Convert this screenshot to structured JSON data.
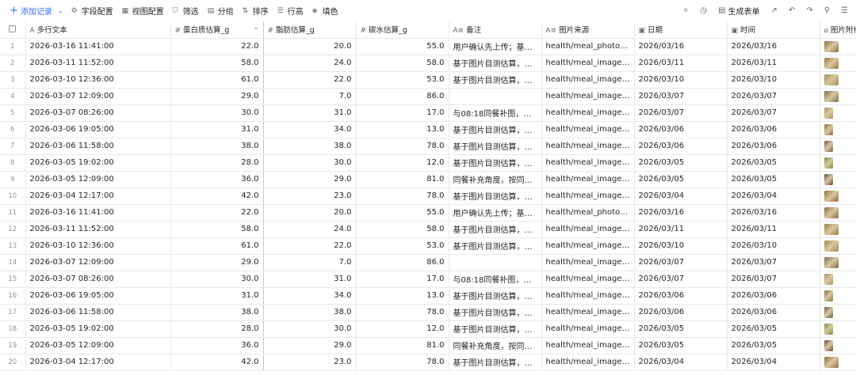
{
  "toolbar": {
    "add_record": "添加记录",
    "items": [
      {
        "label": "字段配置",
        "icon": "gear-icon"
      },
      {
        "label": "视图配置",
        "icon": "view-config-icon"
      },
      {
        "label": "筛选",
        "icon": "filter-icon"
      },
      {
        "label": "分组",
        "icon": "group-icon"
      },
      {
        "label": "排序",
        "icon": "sort-icon"
      },
      {
        "label": "行高",
        "icon": "row-height-icon"
      },
      {
        "label": "填色",
        "icon": "fill-color-icon"
      }
    ],
    "generate_form": "生成表单"
  },
  "columns": [
    {
      "label": "多行文本",
      "icon": "A"
    },
    {
      "label": "蛋白质估算_g",
      "icon": "#"
    },
    {
      "label": "脂肪估算_g",
      "icon": "#"
    },
    {
      "label": "碳水估算_g",
      "icon": "#"
    },
    {
      "label": "备注",
      "icon": "A≡"
    },
    {
      "label": "图片来源",
      "icon": "A≡"
    },
    {
      "label": "日期",
      "icon": "cal"
    },
    {
      "label": "时间",
      "icon": "cal"
    },
    {
      "label": "图片附件",
      "icon": "clip"
    }
  ],
  "rows": [
    {
      "idx": "1",
      "text": "2026-03-16 11:41:00",
      "protein": "22.0",
      "fat": "20.0",
      "carb": "55.0",
      "note": "用户确认先上传；基于...",
      "src": "health/meal_photos/202...",
      "date": "2026/03/16",
      "time": "2026/03/16",
      "thumb": "#8a6a3a"
    },
    {
      "idx": "2",
      "text": "2026-03-11 11:52:00",
      "protein": "58.0",
      "fat": "24.0",
      "carb": "58.0",
      "note": "基于图片目测估算，误...",
      "src": "health/meal_images/20...",
      "date": "2026/03/11",
      "time": "2026/03/11",
      "thumb": "#9a7a40"
    },
    {
      "idx": "3",
      "text": "2026-03-10 12:36:00",
      "protein": "61.0",
      "fat": "22.0",
      "carb": "53.0",
      "note": "基于图片目测估算，误...",
      "src": "health/meal_images/20...",
      "date": "2026/03/10",
      "time": "2026/03/10",
      "thumb": "#a08a50"
    },
    {
      "idx": "4",
      "text": "2026-03-07 12:09:00",
      "protein": "29.0",
      "fat": "7.0",
      "carb": "86.0",
      "note": "",
      "src": "health/meal_images/20...",
      "date": "2026/03/07",
      "time": "2026/03/07",
      "thumb": "#7a6a48"
    },
    {
      "idx": "5",
      "text": "2026-03-07 08:26:00",
      "protein": "30.0",
      "fat": "31.0",
      "carb": "17.0",
      "note": "与08:18同餐补图，按食...",
      "src": "health/meal_images/20...",
      "date": "2026/03/07",
      "time": "2026/03/07",
      "thumb": "#b09060",
      "narrow": true
    },
    {
      "idx": "6",
      "text": "2026-03-06 19:05:00",
      "protein": "31.0",
      "fat": "34.0",
      "carb": "13.0",
      "note": "基于图片目测估算，低...",
      "src": "health/meal_images/20...",
      "date": "2026/03/06",
      "time": "2026/03/06",
      "thumb": "#8a7040",
      "narrow": true
    },
    {
      "idx": "7",
      "text": "2026-03-06 11:58:00",
      "protein": "38.0",
      "fat": "38.0",
      "carb": "78.0",
      "note": "基于图片目测估算，肉...",
      "src": "health/meal_images/20...",
      "date": "2026/03/06",
      "time": "2026/03/06",
      "thumb": "#6a5a48",
      "narrow": true
    },
    {
      "idx": "8",
      "text": "2026-03-05 19:02:00",
      "protein": "28.0",
      "fat": "30.0",
      "carb": "12.0",
      "note": "基于图片目测估算，低...",
      "src": "health/meal_images/20...",
      "date": "2026/03/05",
      "time": "2026/03/05",
      "thumb": "#7a8a40",
      "narrow": true
    },
    {
      "idx": "9",
      "text": "2026-03-05 12:09:00",
      "protein": "36.0",
      "fat": "29.0",
      "carb": "81.0",
      "note": "同餐补充角度，按同一...",
      "src": "health/meal_images/20...",
      "date": "2026/03/05",
      "time": "2026/03/05",
      "thumb": "#5a4a3a",
      "narrow": true
    },
    {
      "idx": "10",
      "text": "2026-03-04 12:17:00",
      "protein": "42.0",
      "fat": "23.0",
      "carb": "78.0",
      "note": "基于图片目测估算，误...",
      "src": "health/meal_images/20...",
      "date": "2026/03/04",
      "time": "2026/03/04",
      "thumb": "#9a6a38"
    },
    {
      "idx": "11",
      "text": "2026-03-16 11:41:00",
      "protein": "22.0",
      "fat": "20.0",
      "carb": "55.0",
      "note": "用户确认先上传；基于...",
      "src": "health/meal_photos/202...",
      "date": "2026/03/16",
      "time": "2026/03/16",
      "thumb": "#8a6a3a"
    },
    {
      "idx": "12",
      "text": "2026-03-11 11:52:00",
      "protein": "58.0",
      "fat": "24.0",
      "carb": "58.0",
      "note": "基于图片目测估算，误...",
      "src": "health/meal_images/20...",
      "date": "2026/03/11",
      "time": "2026/03/11",
      "thumb": "#9a7a40"
    },
    {
      "idx": "13",
      "text": "2026-03-10 12:36:00",
      "protein": "61.0",
      "fat": "22.0",
      "carb": "53.0",
      "note": "基于图片目测估算，误...",
      "src": "health/meal_images/20...",
      "date": "2026/03/10",
      "time": "2026/03/10",
      "thumb": "#a08a50"
    },
    {
      "idx": "14",
      "text": "2026-03-07 12:09:00",
      "protein": "29.0",
      "fat": "7.0",
      "carb": "86.0",
      "note": "",
      "src": "health/meal_images/20...",
      "date": "2026/03/07",
      "time": "2026/03/07",
      "thumb": "#7a6a48"
    },
    {
      "idx": "15",
      "text": "2026-03-07 08:26:00",
      "protein": "30.0",
      "fat": "31.0",
      "carb": "17.0",
      "note": "与08:18同餐补图，按食...",
      "src": "health/meal_images/20...",
      "date": "2026/03/07",
      "time": "2026/03/07",
      "thumb": "#b09060",
      "narrow": true
    },
    {
      "idx": "16",
      "text": "2026-03-06 19:05:00",
      "protein": "31.0",
      "fat": "34.0",
      "carb": "13.0",
      "note": "基于图片目测估算，低...",
      "src": "health/meal_images/20...",
      "date": "2026/03/06",
      "time": "2026/03/06",
      "thumb": "#8a7040",
      "narrow": true
    },
    {
      "idx": "17",
      "text": "2026-03-06 11:58:00",
      "protein": "38.0",
      "fat": "38.0",
      "carb": "78.0",
      "note": "基于图片目测估算，肉...",
      "src": "health/meal_images/20...",
      "date": "2026/03/06",
      "time": "2026/03/06",
      "thumb": "#6a5a48",
      "narrow": true
    },
    {
      "idx": "18",
      "text": "2026-03-05 19:02:00",
      "protein": "28.0",
      "fat": "30.0",
      "carb": "12.0",
      "note": "基于图片目测估算，低...",
      "src": "health/meal_images/20...",
      "date": "2026/03/05",
      "time": "2026/03/05",
      "thumb": "#7a8a40",
      "narrow": true
    },
    {
      "idx": "19",
      "text": "2026-03-05 12:09:00",
      "protein": "36.0",
      "fat": "29.0",
      "carb": "81.0",
      "note": "同餐补充角度，按同一...",
      "src": "health/meal_images/20...",
      "date": "2026/03/05",
      "time": "2026/03/05",
      "thumb": "#5a4a3a",
      "narrow": true
    },
    {
      "idx": "20",
      "text": "2026-03-04 12:17:00",
      "protein": "42.0",
      "fat": "23.0",
      "carb": "78.0",
      "note": "基于图片目测估算，误...",
      "src": "health/meal_images/20...",
      "date": "2026/03/04",
      "time": "2026/03/04",
      "thumb": "#9a6a38"
    }
  ],
  "colors": {
    "accent": "#3370ff",
    "border": "#e8e9eb"
  }
}
